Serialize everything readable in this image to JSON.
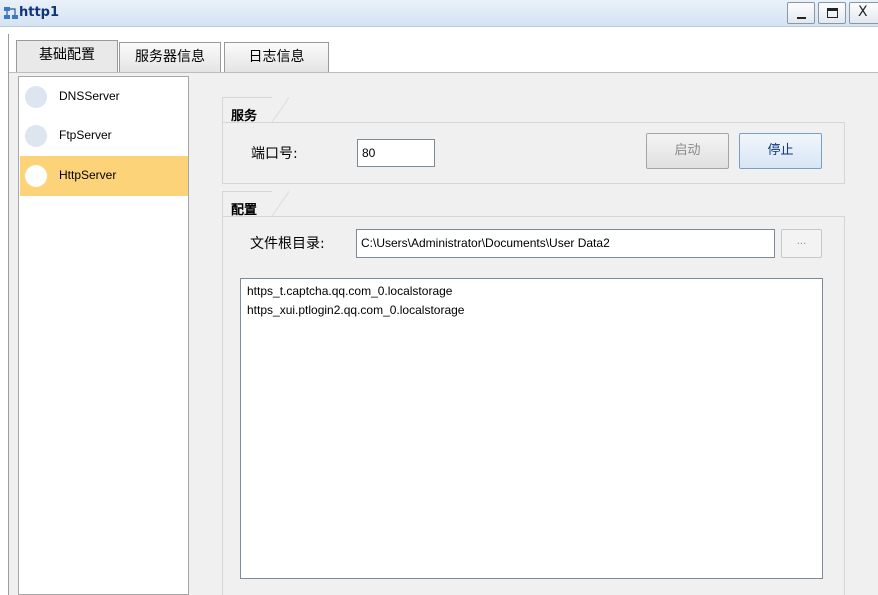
{
  "window": {
    "title": "http1",
    "close_glyph": "X"
  },
  "tabs": [
    {
      "label": "基础配置",
      "active": true
    },
    {
      "label": "服务器信息",
      "active": false
    },
    {
      "label": "日志信息",
      "active": false
    }
  ],
  "servers": [
    {
      "label": "DNSServer",
      "selected": false
    },
    {
      "label": "FtpServer",
      "selected": false
    },
    {
      "label": "HttpServer",
      "selected": true
    }
  ],
  "service": {
    "title": "服务",
    "port_label": "端口号:",
    "port_value": "80",
    "start_label": "启动",
    "stop_label": "停止"
  },
  "config": {
    "title": "配置",
    "root_label": "文件根目录:",
    "root_value": "C:\\Users\\Administrator\\Documents\\User Data2",
    "browse_label": "...",
    "files": [
      "https_t.captcha.qq.com_0.localstorage",
      "https_xui.ptlogin2.qq.com_0.localstorage"
    ]
  },
  "colors": {
    "selected_item": "#fdd37a",
    "title_text": "#10357a"
  }
}
